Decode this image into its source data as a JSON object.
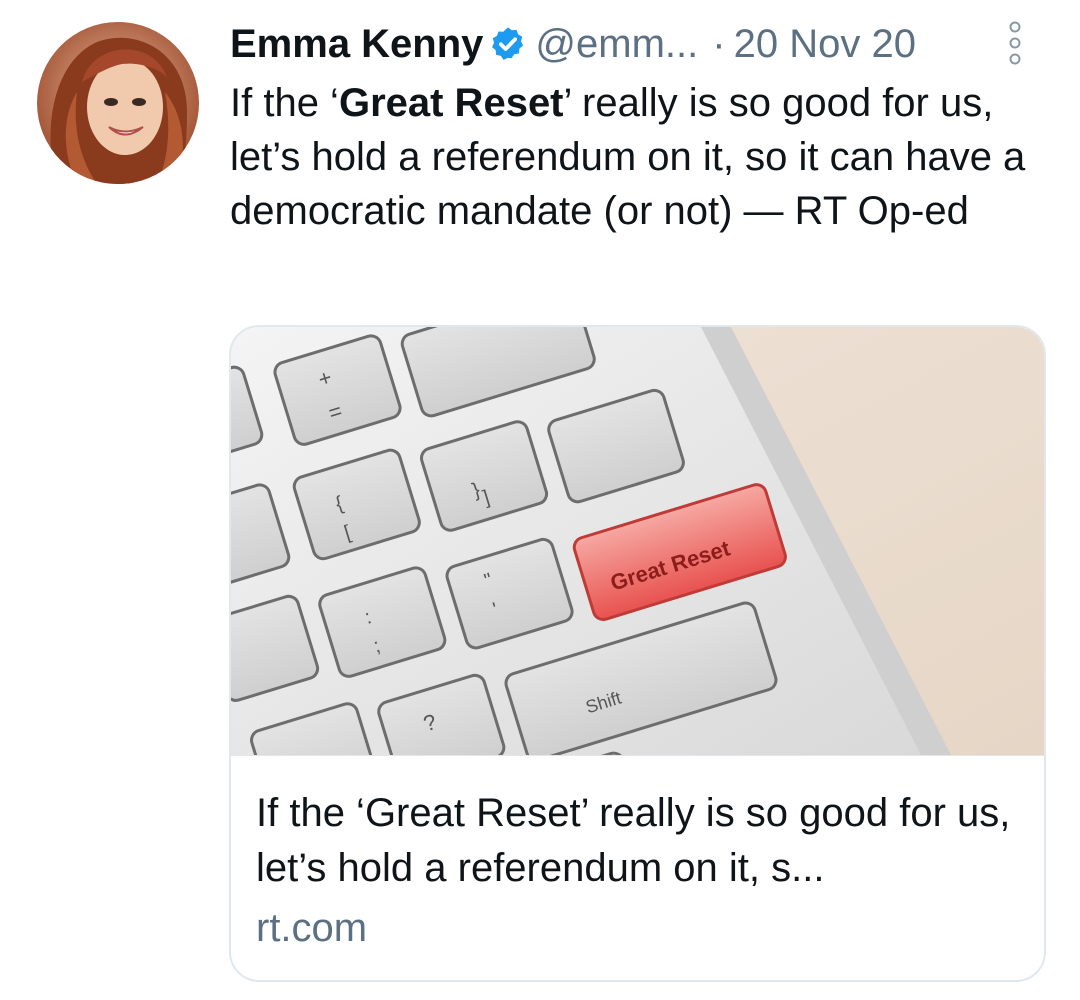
{
  "tweet": {
    "author": {
      "display_name": "Emma Kenny",
      "handle": "@emm...",
      "verified": true,
      "avatar_icon": "profile-photo"
    },
    "separator": "·",
    "date": "20 Nov 20",
    "text": {
      "part1": "If the ‘",
      "bold": "Great Reset",
      "part2": "’ really is so good for us, let’s hold a referendum on it, so it can have a democratic mandate (or not) — RT Op-ed"
    },
    "more_icon": "more-vertical-icon"
  },
  "card": {
    "image_key_labels": {
      "reset_key": "Great Reset",
      "shift_key": "Shift"
    },
    "title": "If the ‘Great Reset’ really is so good for us, let’s hold a referendum on it, s...",
    "domain": "rt.com"
  },
  "colors": {
    "verified_blue": "#1d9bf0",
    "secondary_text": "#5b7083",
    "reset_key_red": "#e8524f",
    "card_border": "#e1e8ed"
  }
}
